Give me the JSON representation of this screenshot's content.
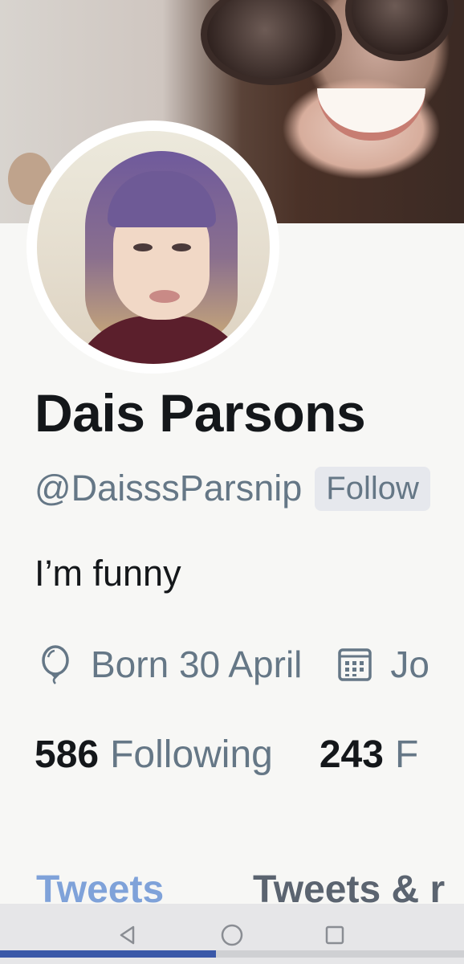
{
  "profile": {
    "name": "Dais Parsons",
    "handle": "@DaisssParsnip",
    "follows_badge": "Follow",
    "bio": "I’m funny",
    "born": "Born 30 April",
    "joined_partial": "Jo",
    "following_count": "586",
    "following_label": "Following",
    "followers_count": "243",
    "followers_label_partial": "F"
  },
  "tabs": {
    "active": "Tweets",
    "next_partial": "Tweets & r"
  },
  "icons": {
    "birthday": "balloon-icon",
    "joined": "calendar-icon",
    "nav_back": "triangle-back-icon",
    "nav_home": "circle-home-icon",
    "nav_recents": "square-recents-icon"
  },
  "colors": {
    "active_tab": "#7fa2d9",
    "secondary_text": "#657786",
    "progress": "#3a58a8"
  },
  "tab_indicator_progress": 0.465
}
